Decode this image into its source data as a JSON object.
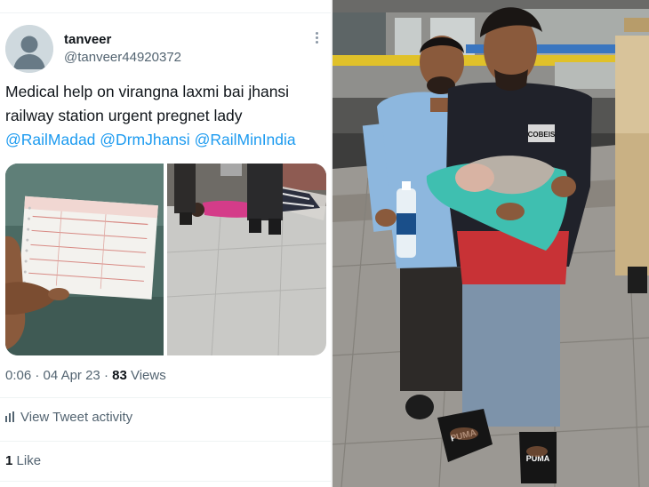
{
  "tweet": {
    "author": {
      "display_name": "tanveer",
      "handle": "@tanveer44920372"
    },
    "text": {
      "line1": "Medical help on virangna laxmi bai jhansi",
      "line2": "railway station urgent pregnet lady",
      "mentions": [
        "@RailMadad",
        "@DrmJhansi",
        "@RailMinIndia"
      ]
    },
    "meta": {
      "time": "0:06",
      "separator": "·",
      "date": "04 Apr 23",
      "views_count": "83",
      "views_label": "Views"
    },
    "activity_label": "View Tweet activity",
    "likes": {
      "count": "1",
      "label": "Like"
    },
    "media_count": 2
  },
  "photo": {
    "tshirt_text": "COBEIS",
    "slipper_brand": "PUMA"
  },
  "colors": {
    "link": "#1d9bf0",
    "secondary_text": "#536471",
    "primary_text": "#0f1419",
    "divider": "#eff3f4"
  },
  "icons": [
    "person-placeholder-icon",
    "more-options-icon",
    "bar-chart-icon"
  ]
}
